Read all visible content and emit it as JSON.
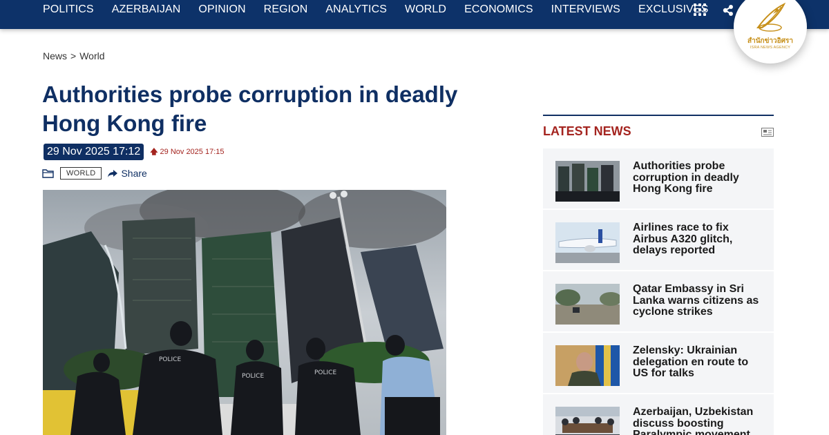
{
  "nav": {
    "items": [
      "POLITICS",
      "AZERBAIJAN",
      "OPINION",
      "REGION",
      "ANALYTICS",
      "WORLD",
      "ECONOMICS",
      "INTERVIEWS",
      "EXCLUSIVES"
    ],
    "menu_icon": "grid-menu-icon",
    "extra_icon": "share-nodes-icon",
    "bar_color": "#0d3269"
  },
  "brand": {
    "thai": "สำนักข่าวอิศรา",
    "en": "ISRA NEWS AGENCY",
    "color": "#c7901a"
  },
  "breadcrumb": {
    "root": "News",
    "separator": ">",
    "current": "World"
  },
  "article": {
    "headline": "Authorities probe corruption in deadly Hong Kong fire",
    "date": "29 Nov 2025 17:12",
    "updated": "29 Nov 2025 17:15",
    "category_tag": "WORLD",
    "share_label": "Share",
    "image_subject": "police officers in front of burning high-rise towers"
  },
  "sidebar": {
    "title": "LATEST NEWS",
    "items": [
      {
        "title": "Authorities probe corruption in deadly Hong Kong fire"
      },
      {
        "title": "Airlines race to fix Airbus A320 glitch, delays reported"
      },
      {
        "title": "Qatar Embassy in Sri Lanka warns citizens as cyclone strikes"
      },
      {
        "title": "Zelensky: Ukrainian delegation en route to US for talks"
      },
      {
        "title": "Azerbaijan, Uzbekistan discuss boosting Paralympic movement"
      }
    ]
  },
  "colors": {
    "headline": "#0f2f63",
    "accent_red": "#a4241f",
    "sidebar_bg": "#f4f5f7"
  }
}
